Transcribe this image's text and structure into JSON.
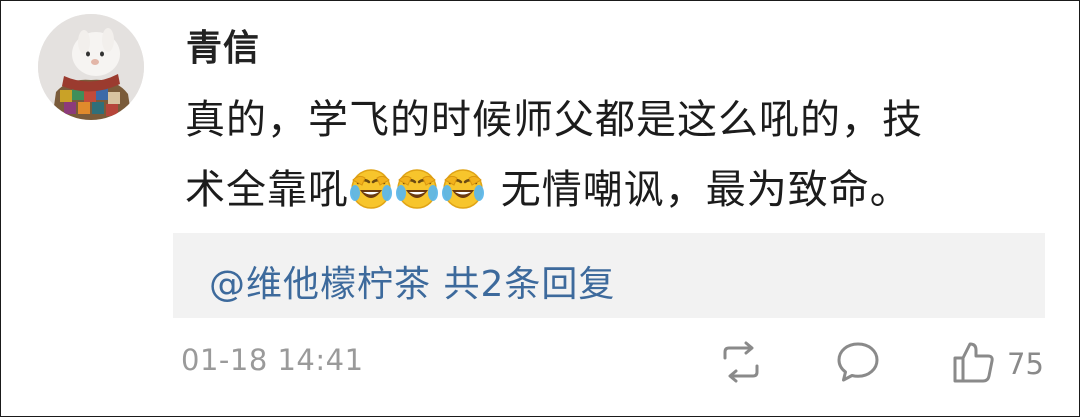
{
  "comment": {
    "username": "青信",
    "text_line1": "真的，学飞的时候师父都是这么吼的，技",
    "text_line2_start": "术全靠吼",
    "text_line2_end": "无情嘲讽，最为致命。",
    "emojis": [
      "laugh-cry-emoji",
      "laugh-cry-emoji",
      "laugh-cry-emoji"
    ],
    "reply_summary": "@维他檬柠茶 共2条回复",
    "timestamp": "01-18 14:41",
    "like_count": "75"
  },
  "colors": {
    "link": "#3d6a9c",
    "meta_gray": "#9a9a9a",
    "icon_gray": "#8a8a8a",
    "reply_bg": "#f2f2f2"
  },
  "icons": {
    "repost": "repost-icon",
    "comment": "comment-icon",
    "like": "thumbs-up-icon"
  }
}
